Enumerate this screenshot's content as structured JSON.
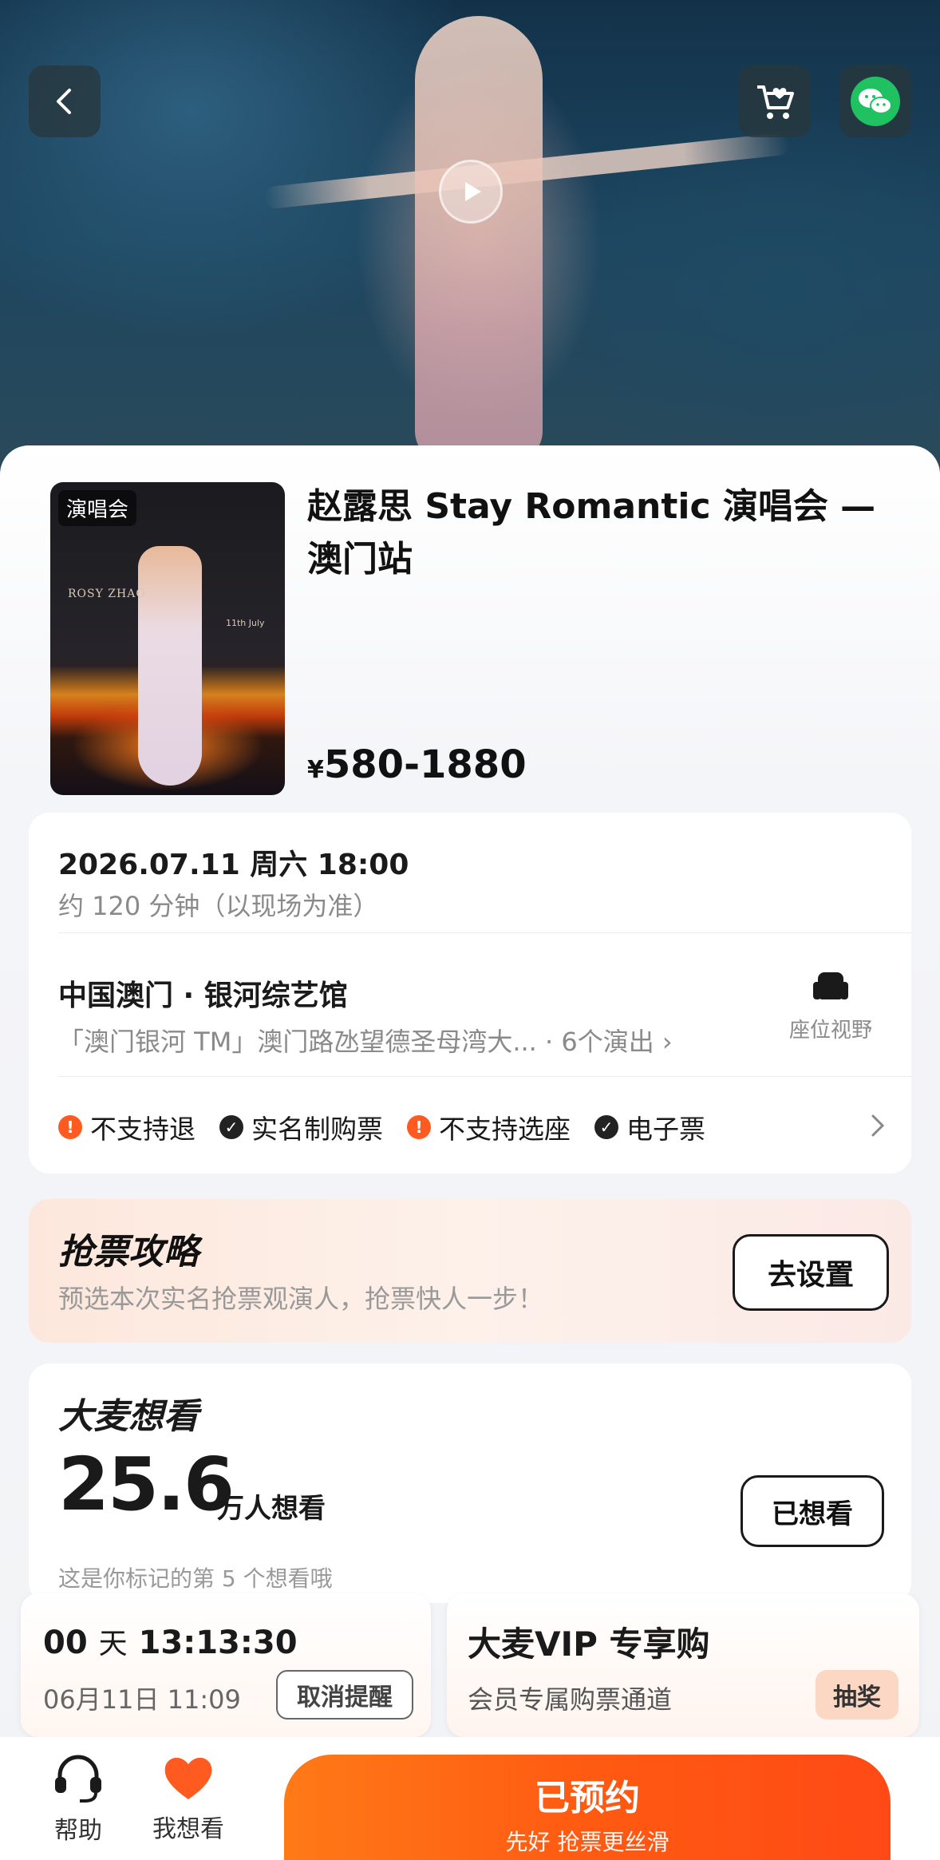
{
  "header": {
    "back_icon": "chevron-left-icon",
    "cart_icon": "cart-heart-icon",
    "share_icon": "wechat-icon",
    "play_icon": "play-icon"
  },
  "event": {
    "poster_tag": "演唱会",
    "poster_name": "ROSY ZHAO",
    "poster_date": "11th July",
    "title": "赵露思 Stay Romantic 演唱会 — 澳门站",
    "price_symbol": "¥",
    "price_range": "580-1880"
  },
  "info": {
    "datetime": "2026.07.11 周六 18:00",
    "duration": "约 120 分钟（以现场为准）",
    "venue": "中国澳门 · 银河综艺馆",
    "address": "「澳门银河 TM」澳门路氹望德圣母湾大...  · 6个演出 ›",
    "seat_view_label": "座位视野",
    "tags": [
      {
        "label": "不支持退",
        "kind": "warn"
      },
      {
        "label": "实名制购票",
        "kind": "ok"
      },
      {
        "label": "不支持选座",
        "kind": "warn"
      },
      {
        "label": "电子票",
        "kind": "ok"
      }
    ]
  },
  "strategy": {
    "title": "抢票攻略",
    "subtitle": "预选本次实名抢票观演人，抢票快人一步！",
    "button": "去设置"
  },
  "wish": {
    "title": "大麦想看",
    "count": "25.6",
    "unit": "万人想看",
    "note": "这是你标记的第 5 个想看哦",
    "button": "已想看"
  },
  "countdown": {
    "days": "00",
    "day_unit": "天",
    "time": "13:13:30",
    "date": "06月11日 11:09",
    "cancel_label": "取消提醒"
  },
  "vip": {
    "title": "大麦VIP 专享购",
    "subtitle": "会员专属购票通道",
    "lottery_label": "抽奖"
  },
  "bottom_nav": {
    "help_label": "帮助",
    "wish_label": "我想看",
    "cta_main": "已预约",
    "cta_sub": "先好 抢票更丝滑"
  },
  "colors": {
    "accent": "#ff5a12",
    "warn": "#ff5a1f"
  }
}
